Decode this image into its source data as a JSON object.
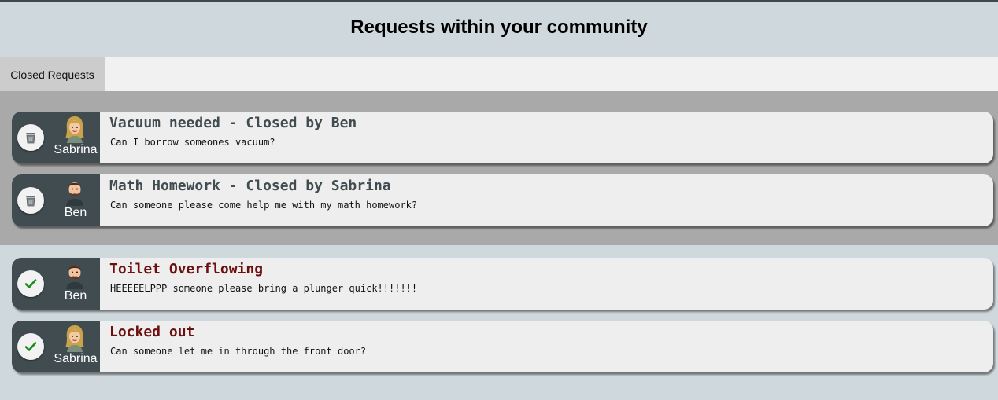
{
  "page": {
    "title": "Requests within your community"
  },
  "tabs": [
    {
      "label": "Closed Requests"
    }
  ],
  "closed_requests": [
    {
      "user": "Sabrina",
      "avatar": "female-avatar-icon",
      "title": "Vacuum needed - Closed by Ben",
      "description": "Can I borrow someones vacuum?",
      "action": "trash-icon"
    },
    {
      "user": "Ben",
      "avatar": "male-avatar-icon",
      "title": "Math Homework - Closed by Sabrina",
      "description": "Can someone please come help me with my math homework?",
      "action": "trash-icon"
    }
  ],
  "open_requests": [
    {
      "user": "Ben",
      "avatar": "male-avatar-icon",
      "title": "Toilet Overflowing",
      "description": "HEEEEELPPP someone please bring a plunger quick!!!!!!!",
      "action": "checkmark-icon"
    },
    {
      "user": "Sabrina",
      "avatar": "female-avatar-icon",
      "title": "Locked out",
      "description": "Can someone let me in through the front door?",
      "action": "checkmark-icon"
    }
  ],
  "colors": {
    "background": "#cfd8dc",
    "card_side": "#414c50",
    "closed_panel": "#a9a9a9",
    "open_title": "#6b0f0f",
    "check": "#1e8c1e"
  }
}
